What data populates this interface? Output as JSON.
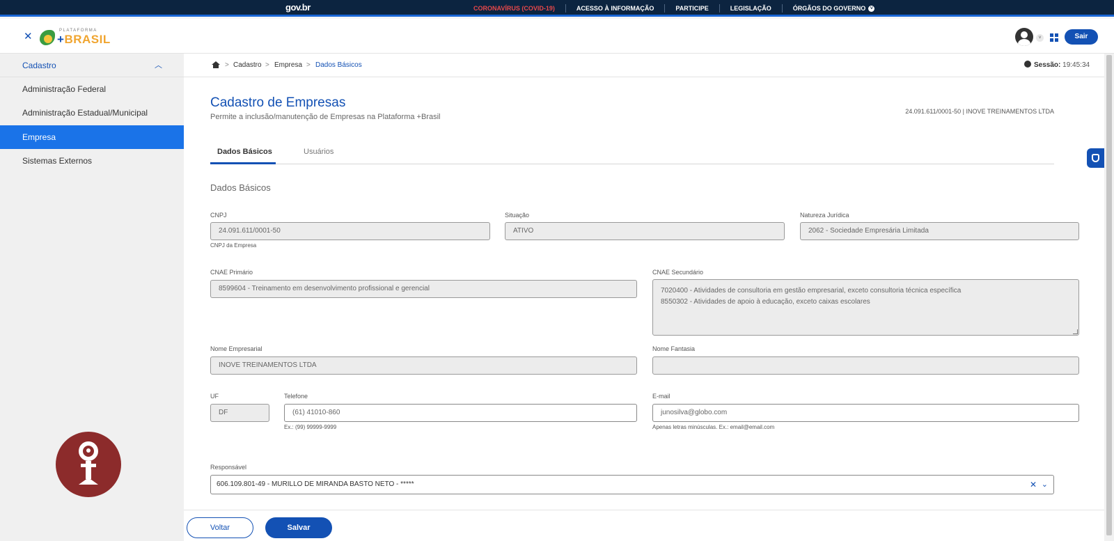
{
  "govbar": {
    "logo": "gov.br",
    "links": [
      "CORONAVÍRUS (COVID-19)",
      "ACESSO À INFORMAÇÃO",
      "PARTICIPE",
      "LEGISLAÇÃO",
      "ÓRGÃOS DO GOVERNO"
    ]
  },
  "header": {
    "brand_small": "PLATAFORMA",
    "brand_plus": "+",
    "brand_main": "BRASIL",
    "logout_label": "Sair"
  },
  "sidebar": {
    "section": "Cadastro",
    "items": [
      {
        "label": "Administração Federal"
      },
      {
        "label": "Administração Estadual/Municipal"
      },
      {
        "label": "Empresa",
        "active": true
      },
      {
        "label": "Sistemas Externos"
      }
    ]
  },
  "breadcrumb": [
    "Cadastro",
    "Empresa",
    "Dados Básicos"
  ],
  "session": {
    "label": "Sessão:",
    "time": "19:45:34"
  },
  "page": {
    "title": "Cadastro de Empresas",
    "subtitle": "Permite a inclusão/manutenção de Empresas na Plataforma +Brasil",
    "company_id": "24.091.611/0001-50 | INOVE TREINAMENTOS LTDA"
  },
  "tabs": [
    {
      "label": "Dados Básicos",
      "active": true
    },
    {
      "label": "Usuários",
      "active": false
    }
  ],
  "form": {
    "section_title": "Dados Básicos",
    "cnpj": {
      "label": "CNPJ",
      "value": "24.091.611/0001-50",
      "hint": "CNPJ da Empresa"
    },
    "situacao": {
      "label": "Situação",
      "value": "ATIVO"
    },
    "natureza": {
      "label": "Natureza Jurídica",
      "value": "2062 - Sociedade Empresária Limitada"
    },
    "cnae_primario": {
      "label": "CNAE Primário",
      "value": "8599604 - Treinamento em desenvolvimento profissional e gerencial"
    },
    "cnae_secundario": {
      "label": "CNAE Secundário",
      "lines": [
        "7020400 - Atividades de consultoria em gestão empresarial, exceto consultoria técnica específica",
        "8550302 - Atividades de apoio à educação, exceto caixas escolares"
      ]
    },
    "nome_empresarial": {
      "label": "Nome Empresarial",
      "value": "INOVE TREINAMENTOS LTDA"
    },
    "nome_fantasia": {
      "label": "Nome Fantasia",
      "value": ""
    },
    "uf": {
      "label": "UF",
      "value": "DF"
    },
    "telefone": {
      "label": "Telefone",
      "value": "(61) 41010-860",
      "hint": "Ex.: (99) 99999-9999"
    },
    "email": {
      "label": "E-mail",
      "value": "junosilva@globo.com",
      "hint": "Apenas letras minúsculas. Ex.: email@email.com"
    },
    "responsavel": {
      "label": "Responsável",
      "value": "606.109.801-49 - MURILLO DE MIRANDA BASTO NETO - *****"
    }
  },
  "footer": {
    "back_label": "Voltar",
    "save_label": "Salvar"
  },
  "colors": {
    "primary": "#1351b4",
    "govbar": "#0c2440",
    "covid": "#e8484a",
    "sidebar_active": "#1a73e8"
  }
}
